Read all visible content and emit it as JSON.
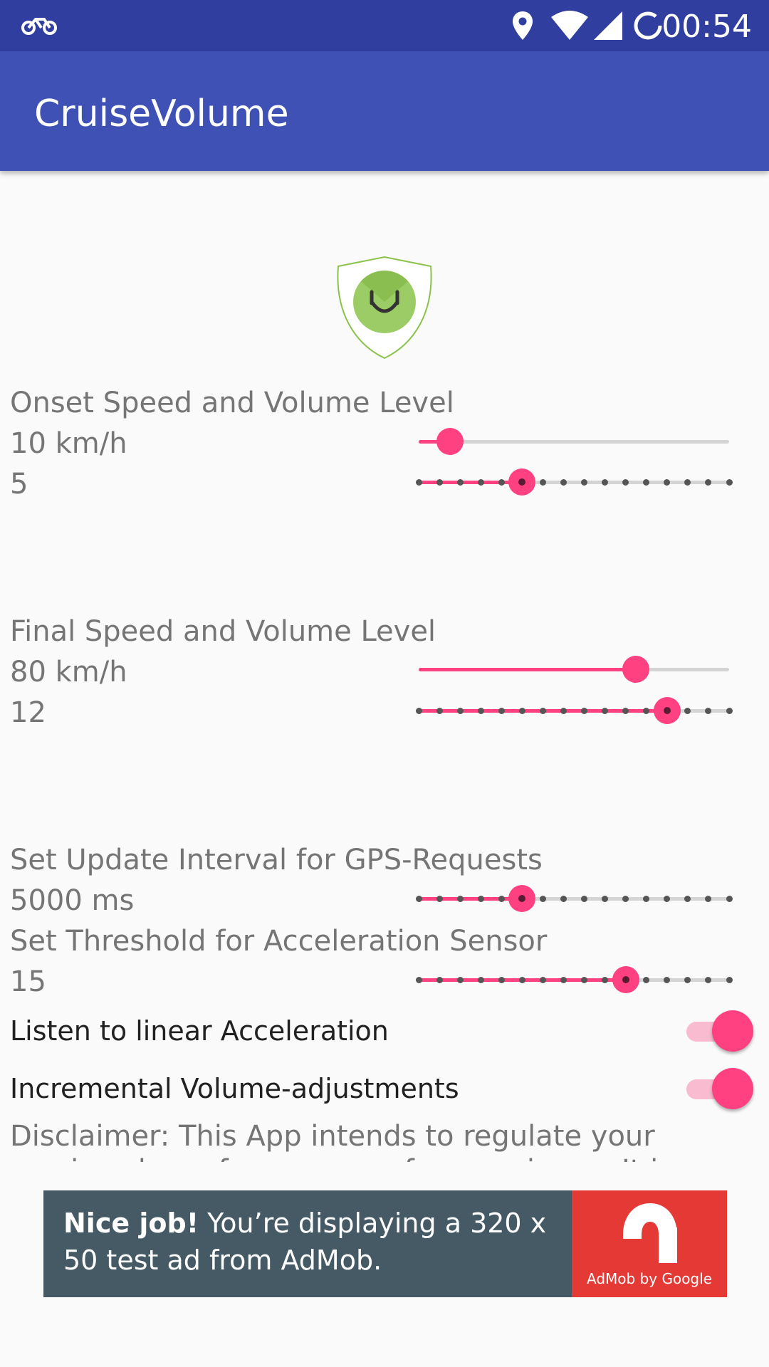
{
  "status_bar": {
    "time": "00:54",
    "icons": [
      "bike-icon",
      "location-icon",
      "wifi-icon",
      "signal-icon",
      "sync-icon"
    ]
  },
  "app_bar": {
    "title": "CruiseVolume"
  },
  "logo": {
    "icon": "smiley-headphone-shield-icon"
  },
  "onset": {
    "title": "Onset Speed and Volume Level",
    "speed_label": "10 km/h",
    "speed_value": 0.1,
    "volume_label": "5",
    "volume_value": 5,
    "volume_max": 15
  },
  "final": {
    "title": "Final Speed and Volume Level",
    "speed_label": "80 km/h",
    "speed_value": 0.7,
    "volume_label": "12",
    "volume_value": 12,
    "volume_max": 15
  },
  "gps": {
    "title": "Set Update Interval for GPS-Requests",
    "value_label": "5000 ms",
    "step": 5,
    "steps": 15
  },
  "accel": {
    "title": "Set Threshold for Acceleration Sensor",
    "value_label": "15",
    "step": 10,
    "steps": 15
  },
  "switches": [
    {
      "label": "Listen to linear Acceleration",
      "on": true
    },
    {
      "label": "Incremental Volume-adjustments",
      "on": true
    }
  ],
  "disclaimer": "Disclaimer: This App intends to regulate your music-volume for reasons of convenience. It is not designed",
  "ad": {
    "headline": "Nice job!",
    "body": " You’re displaying a 320 x 50 test ad from AdMob.",
    "logo_caption": "AdMob by Google"
  },
  "colors": {
    "status_bar": "#303f9f",
    "app_bar": "#3f51b5",
    "accent": "#ff4081",
    "ad_bg": "#455a64",
    "ad_logo_bg": "#e53935"
  }
}
